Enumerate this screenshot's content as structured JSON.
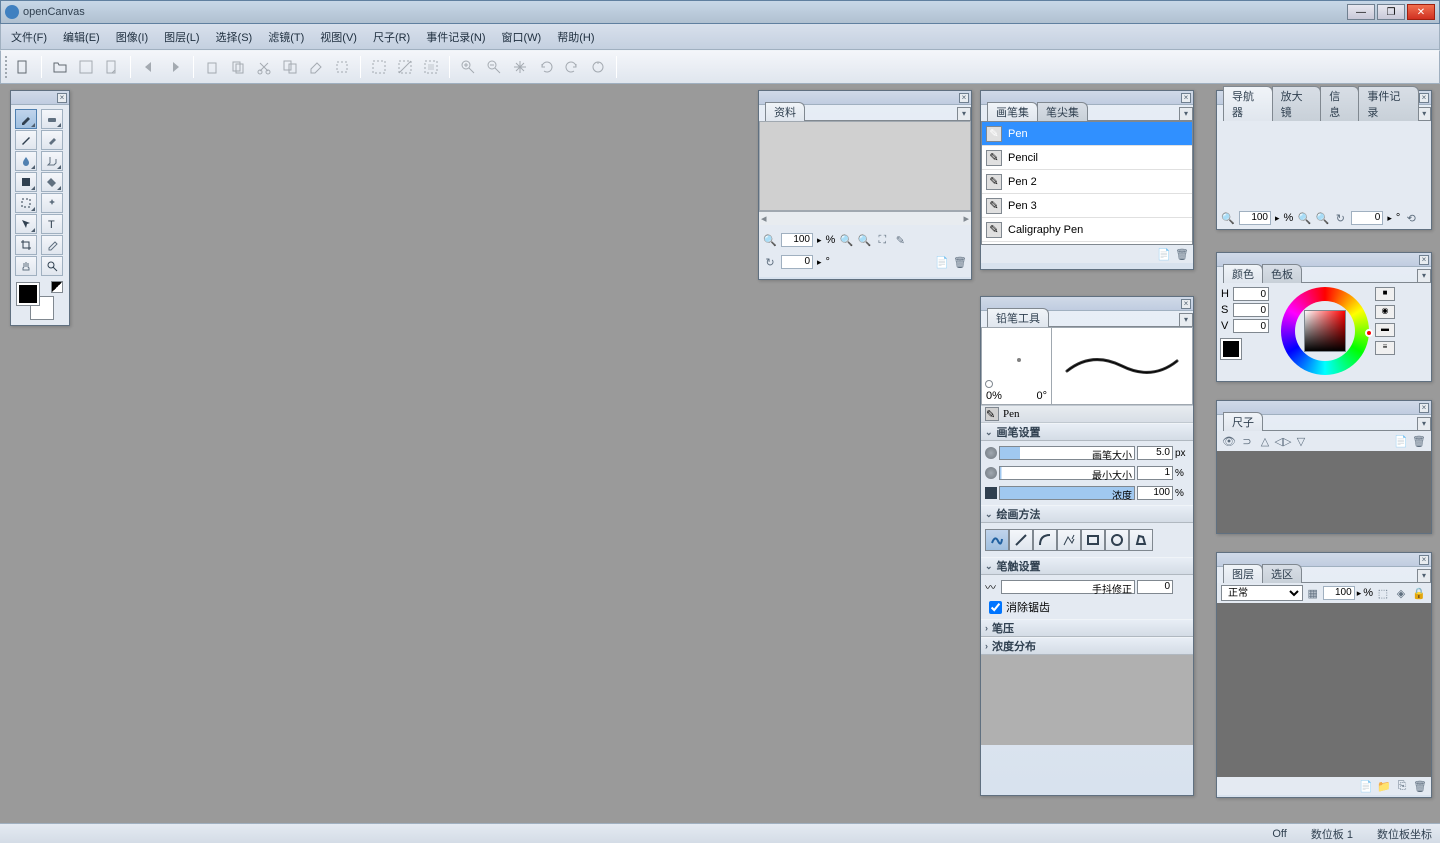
{
  "app": {
    "title": "openCanvas"
  },
  "menus": [
    "文件(F)",
    "编辑(E)",
    "图像(I)",
    "图层(L)",
    "选择(S)",
    "滤镜(T)",
    "视图(V)",
    "尺子(R)",
    "事件记录(N)",
    "窗口(W)",
    "帮助(H)"
  ],
  "info_panel": {
    "tab": "资料",
    "zoom": "100",
    "zoom_unit": "%",
    "angle": "0",
    "angle_unit": "°"
  },
  "brush_panel": {
    "tabs": [
      "画笔集",
      "笔尖集"
    ],
    "items": [
      "Pen",
      "Pencil",
      "Pen 2",
      "Pen 3",
      "Caligraphy Pen"
    ]
  },
  "nav_panel": {
    "tabs": [
      "导航器",
      "放大镜",
      "信息",
      "事件记录"
    ],
    "zoom": "100",
    "zoom_unit": "%",
    "angle": "0",
    "angle_unit": "°"
  },
  "pencil_panel": {
    "tab": "铅笔工具",
    "preview_left": "0%",
    "preview_right": "0°",
    "brush_name": "Pen",
    "sections": {
      "brush_settings": "画笔设置",
      "draw_method": "绘画方法",
      "stroke_settings": "笔触设置",
      "pressure": "笔压",
      "density_dist": "浓度分布"
    },
    "params": {
      "brush_size_label": "画笔大小",
      "brush_size_value": "5.0",
      "brush_size_unit": "px",
      "min_size_label": "最小大小",
      "min_size_value": "1",
      "min_size_unit": "%",
      "density_label": "浓度",
      "density_value": "100",
      "density_unit": "%"
    },
    "shake_label": "手抖修正",
    "shake_value": "0",
    "antialias_label": "消除锯齿"
  },
  "color_panel": {
    "tabs": [
      "颜色",
      "色板"
    ],
    "h": "0",
    "s": "0",
    "v": "0",
    "h_label": "H",
    "s_label": "S",
    "v_label": "V"
  },
  "ruler_panel": {
    "tab": "尺子"
  },
  "layer_panel": {
    "tabs": [
      "图层",
      "选区"
    ],
    "blend_mode": "正常",
    "opacity": "100",
    "opacity_unit": "%"
  },
  "status": {
    "off": "Off",
    "tablet": "数位板 1",
    "coords": "数位板坐标"
  }
}
